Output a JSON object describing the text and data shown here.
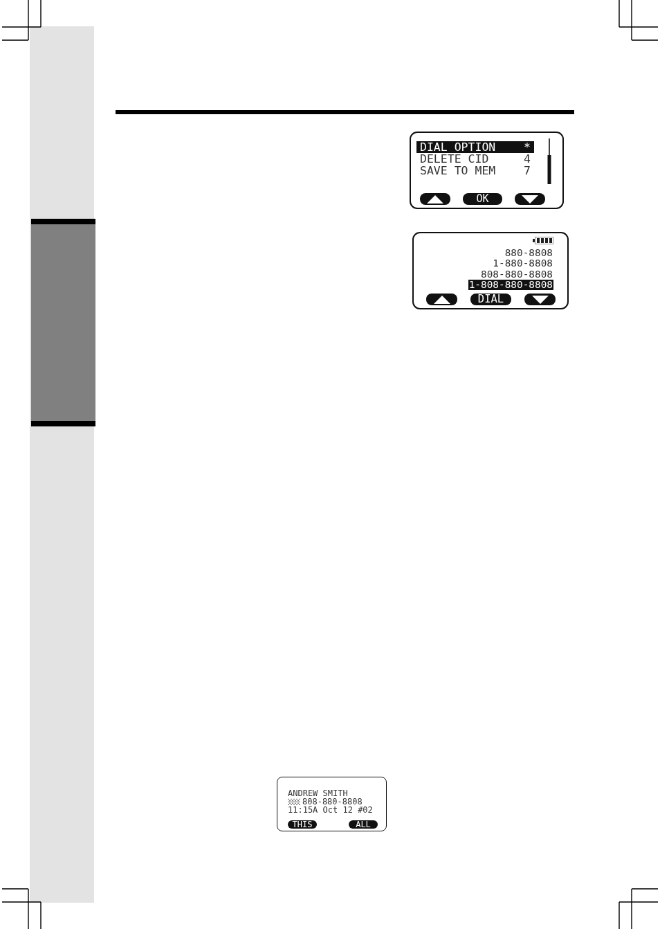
{
  "displays": [
    {
      "kind": "menu",
      "items": [
        {
          "label": "DIAL OPTION",
          "key": "*",
          "selected": true
        },
        {
          "label": "DELETE CID",
          "key": "4",
          "selected": false
        },
        {
          "label": "SAVE TO MEM",
          "key": "7",
          "selected": false
        }
      ],
      "softkeys": [
        {
          "kind": "up"
        },
        {
          "kind": "label",
          "label": "OK"
        },
        {
          "kind": "down"
        }
      ]
    },
    {
      "kind": "numbers",
      "items": [
        {
          "number": "880-8808",
          "selected": false
        },
        {
          "number": "1-880-8808",
          "selected": false
        },
        {
          "number": "808-880-8808",
          "selected": false
        },
        {
          "number": "1-808-880-8808",
          "selected": true
        }
      ],
      "softkeys": [
        {
          "kind": "up"
        },
        {
          "kind": "label",
          "label": "DIAL"
        },
        {
          "kind": "down"
        }
      ]
    },
    {
      "kind": "caller",
      "name": "ANDREW SMITH",
      "number": "808-880-8808",
      "details": "11:15A Oct 12 #02",
      "softkeys": [
        {
          "kind": "label",
          "label": "THIS"
        },
        {
          "kind": "label",
          "label": "ALL"
        }
      ]
    }
  ]
}
